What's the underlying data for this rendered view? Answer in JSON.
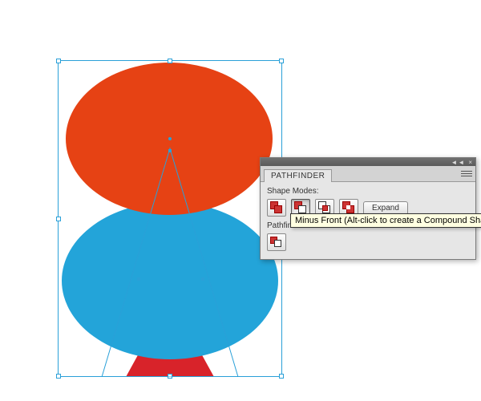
{
  "panel": {
    "title": "PATHFINDER",
    "section1": "Shape Modes:",
    "section2": "Pathfinders:",
    "expand": "Expand",
    "collapse_glyph": "◄◄",
    "close_glyph": "×",
    "modes": {
      "unite": "unite-icon",
      "minus_front": "minus-front-icon",
      "intersect": "intersect-icon",
      "exclude": "exclude-icon"
    }
  },
  "tooltip": {
    "text": "Minus Front (Alt-click to create a Compound Shape"
  },
  "colors": {
    "orange": "#e64214",
    "blue": "#23a4d9",
    "red": "#d8232a",
    "selection": "#2aa0d8"
  }
}
